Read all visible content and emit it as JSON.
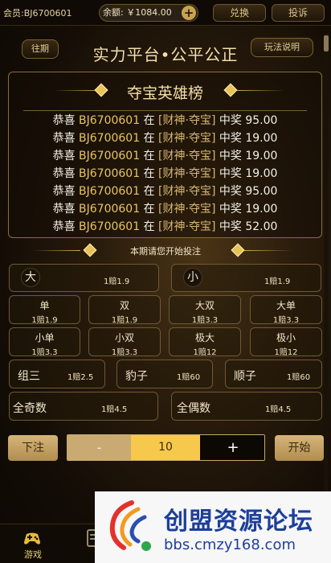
{
  "topbar": {
    "member": "会员:BJ6700601",
    "balance": "余额: ￥1084.00",
    "exchange_label": "兑换",
    "complaint_label": "投诉"
  },
  "header": {
    "period_label": "往期",
    "title": "实力平台•公平公正",
    "rules_label": "玩法说明"
  },
  "hero": {
    "title": "夺宝英雄榜",
    "winners": [
      {
        "prefix": "恭喜",
        "code": "BJ6700601",
        "mid": "在",
        "game": "[财神·夺宝]",
        "win": "中奖",
        "amount": "95.00"
      },
      {
        "prefix": "恭喜",
        "code": "BJ6700601",
        "mid": "在",
        "game": "[财神·夺宝]",
        "win": "中奖",
        "amount": "19.00"
      },
      {
        "prefix": "恭喜",
        "code": "BJ6700601",
        "mid": "在",
        "game": "[财神·夺宝]",
        "win": "中奖",
        "amount": "19.00"
      },
      {
        "prefix": "恭喜",
        "code": "BJ6700601",
        "mid": "在",
        "game": "[财神·夺宝]",
        "win": "中奖",
        "amount": "19.00"
      },
      {
        "prefix": "恭喜",
        "code": "BJ6700601",
        "mid": "在",
        "game": "[财神·夺宝]",
        "win": "中奖",
        "amount": "95.00"
      },
      {
        "prefix": "恭喜",
        "code": "BJ6700601",
        "mid": "在",
        "game": "[财神·夺宝]",
        "win": "中奖",
        "amount": "19.00"
      },
      {
        "prefix": "恭喜",
        "code": "BJ6700601",
        "mid": "在",
        "game": "[财神·夺宝]",
        "win": "中奖",
        "amount": "52.00"
      }
    ]
  },
  "betting": {
    "prompt": "本期请您开始投注",
    "big": {
      "name": "大",
      "odds": "1赔1.9"
    },
    "small": {
      "name": "小",
      "odds": "1赔1.9"
    },
    "row1": [
      {
        "name": "单",
        "odds": "1赔1.9"
      },
      {
        "name": "双",
        "odds": "1赔1.9"
      },
      {
        "name": "大双",
        "odds": "1赔3.3"
      },
      {
        "name": "大单",
        "odds": "1赔3.3"
      }
    ],
    "row2": [
      {
        "name": "小单",
        "odds": "1赔3.3"
      },
      {
        "name": "小双",
        "odds": "1赔3.3"
      },
      {
        "name": "极大",
        "odds": "1赔12"
      },
      {
        "name": "极小",
        "odds": "1赔12"
      }
    ],
    "row3": [
      {
        "name": "组三",
        "odds": "1赔2.5"
      },
      {
        "name": "豹子",
        "odds": "1赔60"
      },
      {
        "name": "顺子",
        "odds": "1赔60"
      }
    ],
    "row4": [
      {
        "name": "全奇数",
        "odds": "1赔4.5"
      },
      {
        "name": "全偶数",
        "odds": "1赔4.5"
      }
    ]
  },
  "controls": {
    "place_bet_label": "下注",
    "minus": "-",
    "amount": "10",
    "plus": "+",
    "start_label": "开始"
  },
  "nav": {
    "game_label": "游戏"
  },
  "watermark": {
    "title": "创盟资源论坛",
    "url": "bbs.cmzy168.com"
  }
}
